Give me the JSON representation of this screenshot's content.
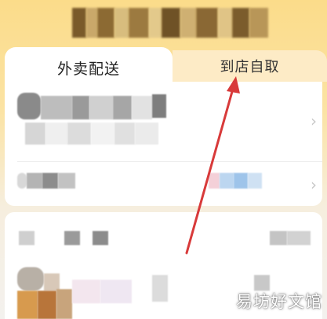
{
  "tabs": {
    "delivery_label": "外卖配送",
    "pickup_label": "到店自取"
  },
  "icons": {
    "row_chevron": "chevron-right-icon",
    "annotation": "red-arrow-annotation"
  },
  "colors": {
    "header_gradient_top": "#fbdc8a",
    "annotation_red": "#d83a3a"
  },
  "watermark": "易坊好文馆"
}
